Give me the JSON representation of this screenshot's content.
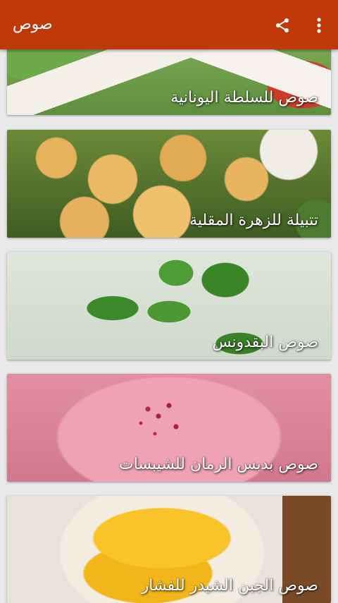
{
  "appbar": {
    "title": "صوص",
    "share_icon": "share-icon",
    "more_icon": "more-vert-icon",
    "color": "#c0390b"
  },
  "items": [
    {
      "label": "صوص للسلطة اليونانية",
      "image": "greek-salad"
    },
    {
      "label": "تتبيلة للزهرة المقلية",
      "image": "fried-cauliflower"
    },
    {
      "label": "صوص البقدونس",
      "image": "parsley-sauce"
    },
    {
      "label": "صوص بدبس الرمان للشيبسات",
      "image": "pomegranate-molasses-sauce"
    },
    {
      "label": "صوص الجبن الشيدر للفشار",
      "image": "cheddar-cheese-sauce"
    }
  ]
}
